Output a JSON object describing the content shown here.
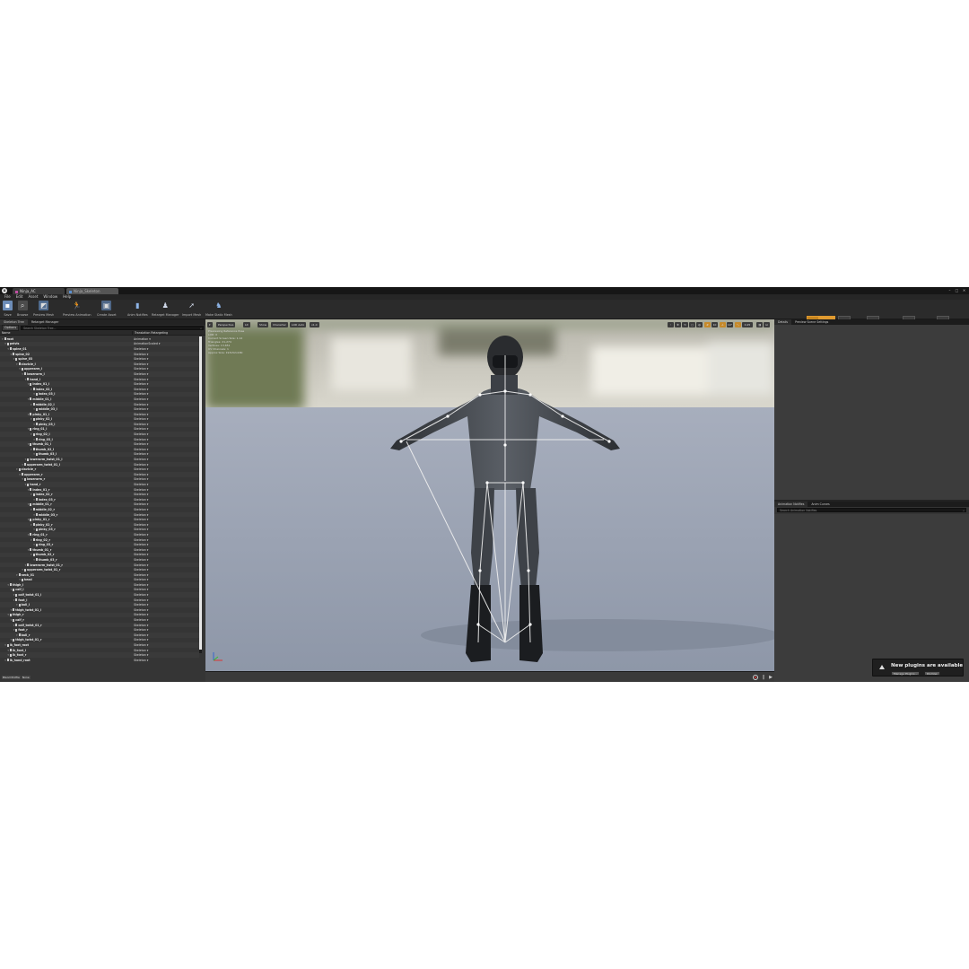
{
  "window": {
    "tab1": "Ninja_AC",
    "tab2": "Ninja_Skeleton"
  },
  "menu": [
    "File",
    "Edit",
    "Asset",
    "Window",
    "Help"
  ],
  "toolbar": {
    "buttons": [
      "Save",
      "Browse",
      "Preview Mesh",
      "Preview Animation",
      "Create Asset",
      "Anim Notifies",
      "Retarget Manager",
      "Import Mesh",
      "Make Static Mesh"
    ]
  },
  "modes": [
    "Skeleton",
    "Mesh",
    "Animation",
    "Blueprint",
    "Physics"
  ],
  "left_panel": {
    "tabs": [
      "Skeleton Tree",
      "Retarget Manager"
    ],
    "options_label": "Options",
    "search_placeholder": "Search Skeleton Tree...",
    "columns": [
      "Name",
      "Translation Retargeting"
    ],
    "bottom": [
      "Blend Profile",
      "None"
    ],
    "bones": [
      {
        "name": "root",
        "depth": 0,
        "retarget": "Animation"
      },
      {
        "name": "pelvis",
        "depth": 1,
        "retarget": "AnimationScaled"
      },
      {
        "name": "spine_01",
        "depth": 2,
        "retarget": "Skeleton"
      },
      {
        "name": "spine_02",
        "depth": 3,
        "retarget": "Skeleton"
      },
      {
        "name": "spine_03",
        "depth": 4,
        "retarget": "Skeleton"
      },
      {
        "name": "clavicle_l",
        "depth": 5,
        "retarget": "Skeleton"
      },
      {
        "name": "upperarm_l",
        "depth": 6,
        "retarget": "Skeleton"
      },
      {
        "name": "lowerarm_l",
        "depth": 7,
        "retarget": "Skeleton"
      },
      {
        "name": "hand_l",
        "depth": 8,
        "retarget": "Skeleton"
      },
      {
        "name": "index_01_l",
        "depth": 9,
        "retarget": "Skeleton"
      },
      {
        "name": "index_02_l",
        "depth": 10,
        "retarget": "Skeleton"
      },
      {
        "name": "index_03_l",
        "depth": 11,
        "retarget": "Skeleton"
      },
      {
        "name": "middle_01_l",
        "depth": 9,
        "retarget": "Skeleton"
      },
      {
        "name": "middle_02_l",
        "depth": 10,
        "retarget": "Skeleton"
      },
      {
        "name": "middle_03_l",
        "depth": 11,
        "retarget": "Skeleton"
      },
      {
        "name": "pinky_01_l",
        "depth": 9,
        "retarget": "Skeleton"
      },
      {
        "name": "pinky_02_l",
        "depth": 10,
        "retarget": "Skeleton"
      },
      {
        "name": "pinky_03_l",
        "depth": 11,
        "retarget": "Skeleton"
      },
      {
        "name": "ring_01_l",
        "depth": 9,
        "retarget": "Skeleton"
      },
      {
        "name": "ring_02_l",
        "depth": 10,
        "retarget": "Skeleton"
      },
      {
        "name": "ring_03_l",
        "depth": 11,
        "retarget": "Skeleton"
      },
      {
        "name": "thumb_01_l",
        "depth": 9,
        "retarget": "Skeleton"
      },
      {
        "name": "thumb_02_l",
        "depth": 10,
        "retarget": "Skeleton"
      },
      {
        "name": "thumb_03_l",
        "depth": 11,
        "retarget": "Skeleton"
      },
      {
        "name": "lowerarm_twist_01_l",
        "depth": 8,
        "retarget": "Skeleton"
      },
      {
        "name": "upperarm_twist_01_l",
        "depth": 7,
        "retarget": "Skeleton"
      },
      {
        "name": "clavicle_r",
        "depth": 5,
        "retarget": "Skeleton"
      },
      {
        "name": "upperarm_r",
        "depth": 6,
        "retarget": "Skeleton"
      },
      {
        "name": "lowerarm_r",
        "depth": 7,
        "retarget": "Skeleton"
      },
      {
        "name": "hand_r",
        "depth": 8,
        "retarget": "Skeleton"
      },
      {
        "name": "index_01_r",
        "depth": 9,
        "retarget": "Skeleton"
      },
      {
        "name": "index_02_r",
        "depth": 10,
        "retarget": "Skeleton"
      },
      {
        "name": "index_03_r",
        "depth": 11,
        "retarget": "Skeleton"
      },
      {
        "name": "middle_01_r",
        "depth": 9,
        "retarget": "Skeleton"
      },
      {
        "name": "middle_02_r",
        "depth": 10,
        "retarget": "Skeleton"
      },
      {
        "name": "middle_03_r",
        "depth": 11,
        "retarget": "Skeleton"
      },
      {
        "name": "pinky_01_r",
        "depth": 9,
        "retarget": "Skeleton"
      },
      {
        "name": "pinky_02_r",
        "depth": 10,
        "retarget": "Skeleton"
      },
      {
        "name": "pinky_03_r",
        "depth": 11,
        "retarget": "Skeleton"
      },
      {
        "name": "ring_01_r",
        "depth": 9,
        "retarget": "Skeleton"
      },
      {
        "name": "ring_02_r",
        "depth": 10,
        "retarget": "Skeleton"
      },
      {
        "name": "ring_03_r",
        "depth": 11,
        "retarget": "Skeleton"
      },
      {
        "name": "thumb_01_r",
        "depth": 9,
        "retarget": "Skeleton"
      },
      {
        "name": "thumb_02_r",
        "depth": 10,
        "retarget": "Skeleton"
      },
      {
        "name": "thumb_03_r",
        "depth": 11,
        "retarget": "Skeleton"
      },
      {
        "name": "lowerarm_twist_01_r",
        "depth": 8,
        "retarget": "Skeleton"
      },
      {
        "name": "upperarm_twist_01_r",
        "depth": 7,
        "retarget": "Skeleton"
      },
      {
        "name": "neck_01",
        "depth": 5,
        "retarget": "Skeleton"
      },
      {
        "name": "head",
        "depth": 6,
        "retarget": "Skeleton"
      },
      {
        "name": "thigh_l",
        "depth": 2,
        "retarget": "Skeleton"
      },
      {
        "name": "calf_l",
        "depth": 3,
        "retarget": "Skeleton"
      },
      {
        "name": "calf_twist_01_l",
        "depth": 4,
        "retarget": "Skeleton"
      },
      {
        "name": "foot_l",
        "depth": 4,
        "retarget": "Skeleton"
      },
      {
        "name": "ball_l",
        "depth": 5,
        "retarget": "Skeleton"
      },
      {
        "name": "thigh_twist_01_l",
        "depth": 3,
        "retarget": "Skeleton"
      },
      {
        "name": "thigh_r",
        "depth": 2,
        "retarget": "Skeleton"
      },
      {
        "name": "calf_r",
        "depth": 3,
        "retarget": "Skeleton"
      },
      {
        "name": "calf_twist_01_r",
        "depth": 4,
        "retarget": "Skeleton"
      },
      {
        "name": "foot_r",
        "depth": 4,
        "retarget": "Skeleton"
      },
      {
        "name": "ball_r",
        "depth": 5,
        "retarget": "Skeleton"
      },
      {
        "name": "thigh_twist_01_r",
        "depth": 3,
        "retarget": "Skeleton"
      },
      {
        "name": "ik_foot_root",
        "depth": 1,
        "retarget": "Skeleton"
      },
      {
        "name": "ik_foot_l",
        "depth": 2,
        "retarget": "Skeleton"
      },
      {
        "name": "ik_foot_r",
        "depth": 2,
        "retarget": "Skeleton"
      },
      {
        "name": "ik_hand_root",
        "depth": 1,
        "retarget": "Skeleton"
      }
    ]
  },
  "viewport": {
    "buttons": [
      "Perspective",
      "Lit",
      "Show",
      "Character",
      "LOD Auto",
      "x1.0"
    ],
    "right_buttons": [
      "0.25",
      "10"
    ],
    "stats": [
      "Previewing Reference Pose",
      "LOD: 0",
      "Current Screen Size: 1.12",
      "Triangles: 21,274",
      "Vertices: 13,651",
      "UV Channels: 1",
      "Approx Size: 193x52x180"
    ]
  },
  "right_panel": {
    "top_tabs": [
      "Details",
      "Preview Scene Settings"
    ],
    "bottom_tabs": [
      "Animation Notifies",
      "Anim Curves"
    ],
    "search_placeholder": "Search Animation Notifies"
  },
  "notification": {
    "message": "New plugins are available",
    "manage_label": "Manage Plugins...",
    "dismiss_label": "Dismiss"
  },
  "colors": {
    "accent": "#e09a30",
    "panel": "#353535",
    "viewport_floor": "#9aa3b3"
  }
}
